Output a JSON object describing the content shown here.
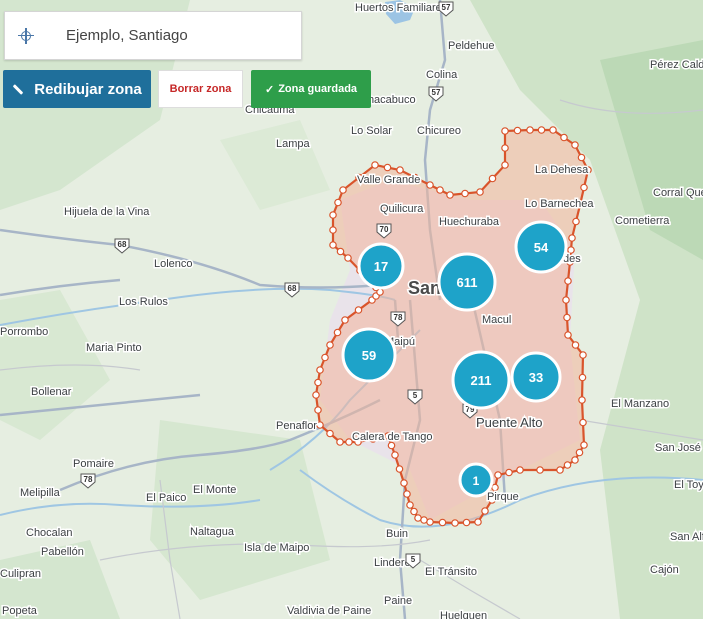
{
  "search": {
    "value": "Ejemplo, Santiago"
  },
  "toolbar": {
    "redraw_label": "Redibujar zona",
    "clear_label": "Borrar zona",
    "saved_label": "Zona guardada"
  },
  "map": {
    "city_label": "Santiago",
    "places": [
      "Huertos Familiares",
      "Peldehue",
      "Colina",
      "Pérez Caldera",
      "Lo Solar",
      "Chicureo",
      "Lampa",
      "La Dehesa",
      "Valle Grande",
      "Quilicura",
      "Huechuraba",
      "Corral Quemado",
      "Lo Barnechea",
      "Cometierra",
      "Hijuela de la Vina",
      "Lolenco",
      "Los Rulos",
      "Macul",
      "Maria Pinto",
      "Bollenar",
      "Penaflor",
      "Calera de Tango",
      "Puente Alto",
      "El Manzano",
      "San José de Maipo",
      "Pomaire",
      "El Toyo",
      "Melipilla",
      "El Paico",
      "El Monte",
      "Pirque",
      "Naltagua",
      "Isla de Maipo",
      "Buin",
      "Chocalan",
      "Pabellón",
      "San Alfonso",
      "Linderos",
      "Culipran",
      "El Tránsito",
      "Paine",
      "Popeta",
      "Valdivia de Paine",
      "Huelquen",
      "Maipú",
      "Chicauma",
      "Bollenar",
      "Porrombo",
      "Chacabuco",
      "Las Condes",
      "Cajón"
    ],
    "route_shields": [
      "57",
      "57",
      "70",
      "68",
      "68",
      "78",
      "5",
      "78",
      "79",
      "5"
    ],
    "clusters": [
      {
        "count": "17"
      },
      {
        "count": "611"
      },
      {
        "count": "54"
      },
      {
        "count": "59"
      },
      {
        "count": "211"
      },
      {
        "count": "33"
      },
      {
        "count": "1"
      }
    ]
  },
  "colors": {
    "zone_stroke": "#d9542b",
    "zone_fill": "#f3b49a",
    "cluster": "#1ea3c9",
    "redraw_bg": "#1f6f9b",
    "saved_bg": "#2e9e4a",
    "clear_text": "#c62828"
  }
}
